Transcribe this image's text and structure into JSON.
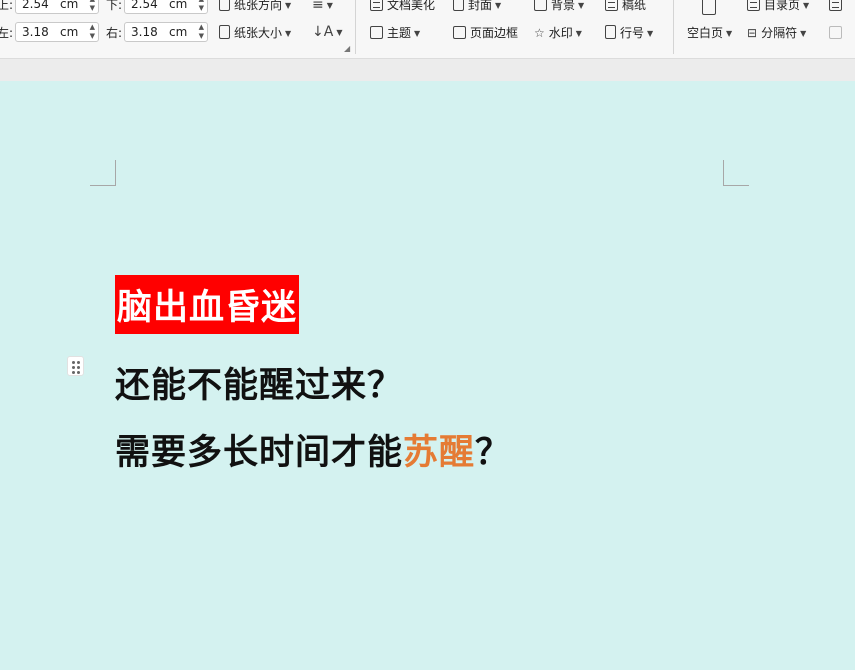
{
  "ribbon": {
    "margins": {
      "top": {
        "label": "上:",
        "value": "2.54",
        "unit": "cm"
      },
      "bottom": {
        "label": "下:",
        "value": "2.54",
        "unit": "cm"
      },
      "left": {
        "label": "左:",
        "value": "3.18",
        "unit": "cm"
      },
      "right": {
        "label": "右:",
        "value": "3.18",
        "unit": "cm"
      }
    },
    "orientation": "纸张方向",
    "size": "纸张大小",
    "beautify": "文档美化",
    "theme": "主题",
    "cover": "封面",
    "border": "页面边框",
    "background": "背景",
    "watermark": "水印",
    "manuscript": "稿纸",
    "line_number": "行号",
    "blank_page": "空白页",
    "toc_page": "目录页",
    "separator": "分隔符"
  },
  "document": {
    "line1": "脑出血昏迷",
    "line2": "还能不能醒过来？",
    "line3_prefix": "需要多长时间才能",
    "line3_accent": "苏醒",
    "line3_suffix": "？"
  },
  "colors": {
    "page_background": "#d4f2f0",
    "highlight": "#ff0000",
    "accent": "#e57b34"
  }
}
